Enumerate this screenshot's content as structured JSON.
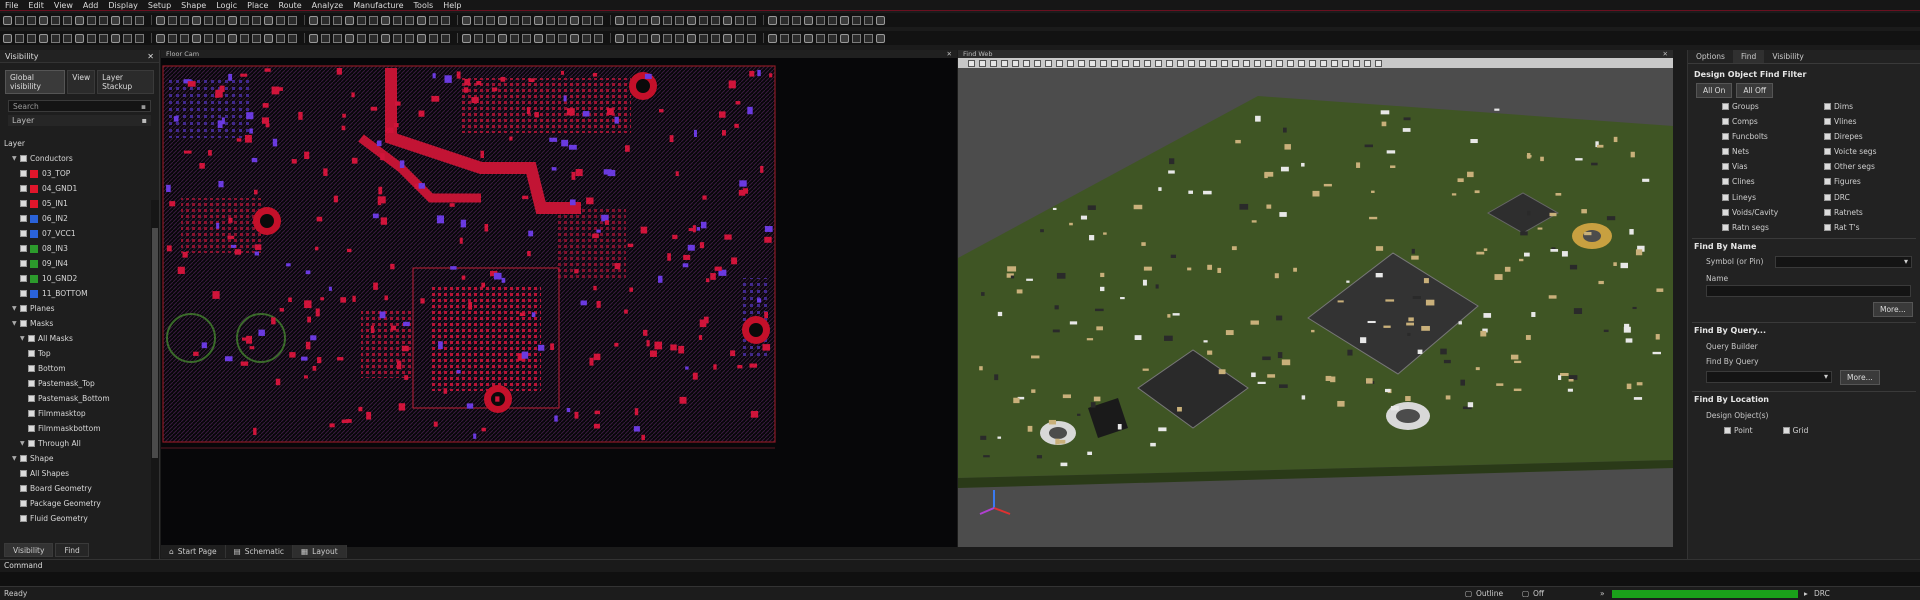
{
  "menu": [
    "File",
    "Edit",
    "View",
    "Add",
    "Display",
    "Setup",
    "Shape",
    "Logic",
    "Place",
    "Route",
    "Analyze",
    "Manufacture",
    "Tools",
    "Help"
  ],
  "left_panel": {
    "title": "Visibility",
    "tabs": [
      "Global visibility",
      "View",
      "Layer Stackup"
    ],
    "search_placeholder": "Search",
    "layer_header": "Layer",
    "tree": [
      {
        "label": "Layer",
        "level": 0,
        "type": "text"
      },
      {
        "label": "Conductors",
        "level": 1,
        "type": "group"
      },
      {
        "label": "03_TOP",
        "level": 2,
        "color": "#e0162b"
      },
      {
        "label": "04_GND1",
        "level": 2,
        "color": "#e0162b"
      },
      {
        "label": "05_IN1",
        "level": 2,
        "color": "#e0162b"
      },
      {
        "label": "06_IN2",
        "level": 2,
        "color": "#2a62d8"
      },
      {
        "label": "07_VCC1",
        "level": 2,
        "color": "#2a62d8"
      },
      {
        "label": "08_IN3",
        "level": 2,
        "color": "#2c9a2c"
      },
      {
        "label": "09_IN4",
        "level": 2,
        "color": "#2c9a2c"
      },
      {
        "label": "10_GND2",
        "level": 2,
        "color": "#2c9a2c"
      },
      {
        "label": "11_BOTTOM",
        "level": 2,
        "color": "#2a62d8"
      },
      {
        "label": "Planes",
        "level": 1,
        "type": "group"
      },
      {
        "label": "Masks",
        "level": 1,
        "type": "group"
      },
      {
        "label": "All Masks",
        "level": 2,
        "type": "group"
      },
      {
        "label": "Top",
        "level": 3
      },
      {
        "label": "Bottom",
        "level": 3
      },
      {
        "label": "Pastemask_Top",
        "level": 3
      },
      {
        "label": "Pastemask_Bottom",
        "level": 3
      },
      {
        "label": "Filmmasktop",
        "level": 3
      },
      {
        "label": "Filmmaskbottom",
        "level": 3
      },
      {
        "label": "Through All",
        "level": 2,
        "type": "group"
      },
      {
        "label": "Shape",
        "level": 1,
        "type": "group"
      },
      {
        "label": "All Shapes",
        "level": 2
      },
      {
        "label": "Board Geometry",
        "level": 2
      },
      {
        "label": "Package Geometry",
        "level": 2
      },
      {
        "label": "Fluid Geometry",
        "level": 2
      }
    ],
    "bottom_tabs": [
      "Visibility",
      "Find"
    ]
  },
  "pcb_view": {
    "title": "Floor Cam",
    "doc_tabs": [
      "Start Page",
      "Schematic",
      "Layout"
    ]
  },
  "view3d": {
    "title": "Find Web"
  },
  "right_panel": {
    "tabs": [
      "Options",
      "Find",
      "Visibility"
    ],
    "filter_title": "Design Object Find Filter",
    "all_on": "All On",
    "all_off": "All Off",
    "filters_left": [
      "Groups",
      "Comps",
      "Funcbolts",
      "Nets",
      "Vias",
      "Clines",
      "Lineys",
      "Voids/Cavity",
      "Ratn segs"
    ],
    "filters_right": [
      "Dims",
      "Vlines",
      "Direpes",
      "Voicte segs",
      "Other segs",
      "Figures",
      "DRC",
      "Ratnets",
      "Rat T's"
    ],
    "find_by_name": "Find By Name",
    "symbol_label": "Symbol (or Pin)",
    "name_label": "Name",
    "more": "More...",
    "find_by_query": "Find By Query...",
    "query_builder": "Query Builder",
    "find_by_query_label": "Find By Query",
    "find_by_location": "Find By Location",
    "design_objects": "Design Object(s)",
    "point": "Point",
    "grid": "Grid"
  },
  "command": {
    "label": "Command"
  },
  "status": {
    "ready": "Ready",
    "outline": "Outline",
    "off": "Off",
    "drc": "DRC"
  }
}
